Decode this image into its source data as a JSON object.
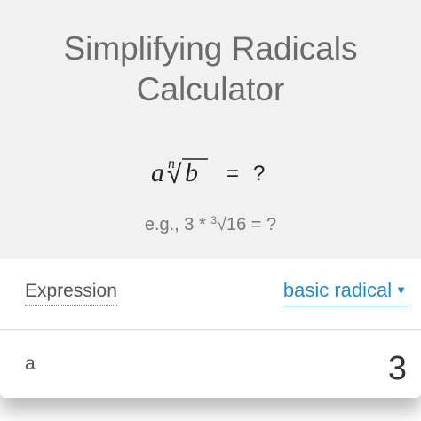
{
  "title": {
    "line1": "Simplifying Radicals",
    "line2": "Calculator"
  },
  "formula": {
    "coefficient": "a",
    "index": "n",
    "radicand": "b",
    "radical_sign": "√",
    "equals": "=",
    "result": "?"
  },
  "example": {
    "prefix": "e.g., 3 * ",
    "index": "3",
    "rest": "√16 = ?"
  },
  "expression": {
    "label": "Expression",
    "selected_option": "basic radical",
    "caret": "▼"
  },
  "field_a": {
    "label": "a",
    "value": "3"
  },
  "colors": {
    "header_background": "#f1f1f1",
    "title_text": "#6a6a6a",
    "link_accent": "#1a8ccf"
  }
}
